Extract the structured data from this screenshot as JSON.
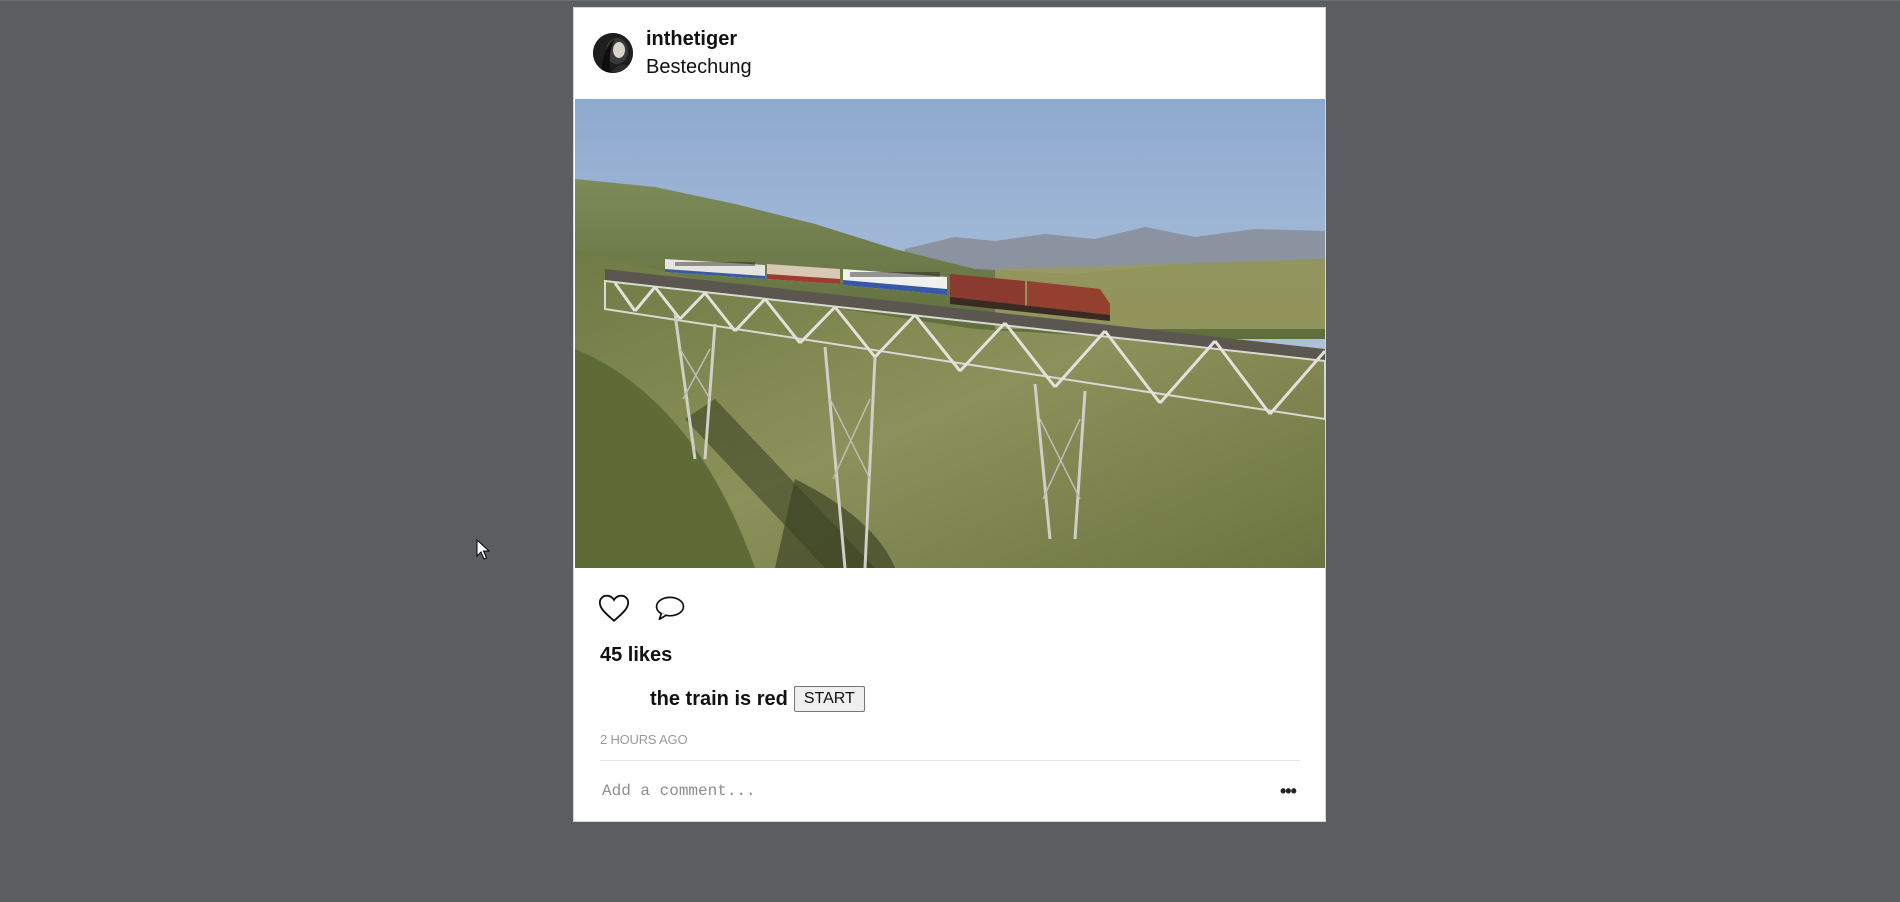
{
  "post": {
    "username": "inthetiger",
    "location": "Bestechung",
    "likes_text": "45 likes",
    "caption": "the train is red",
    "start_button": "START",
    "timestamp": "2 HOURS AGO",
    "comment_placeholder": "Add a comment...",
    "more_label": "•••"
  },
  "icons": {
    "like": "heart-icon",
    "comment": "speech-bubble-icon",
    "more": "ellipsis-icon",
    "cursor": "mouse-pointer-icon"
  },
  "colors": {
    "page_background": "#5a5e61",
    "card_background": "#ffffff",
    "timestamp_text": "#999999"
  }
}
